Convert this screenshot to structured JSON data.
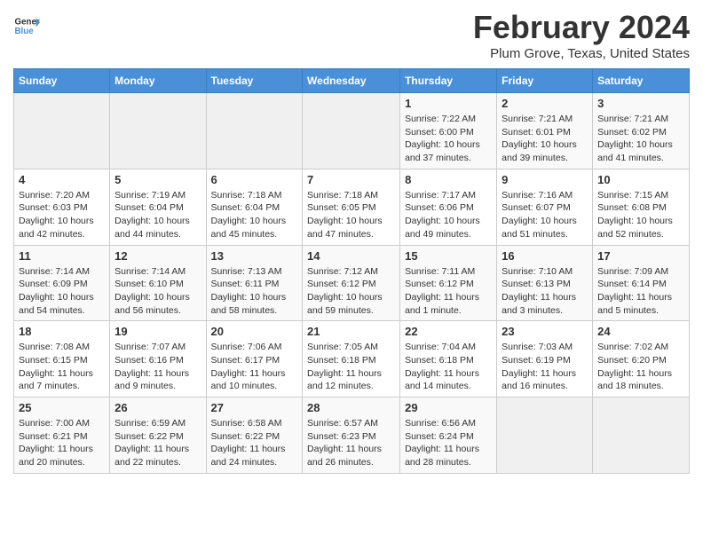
{
  "logo": {
    "line1": "General",
    "line2": "Blue"
  },
  "title": "February 2024",
  "subtitle": "Plum Grove, Texas, United States",
  "days_of_week": [
    "Sunday",
    "Monday",
    "Tuesday",
    "Wednesday",
    "Thursday",
    "Friday",
    "Saturday"
  ],
  "weeks": [
    [
      {
        "num": "",
        "info": ""
      },
      {
        "num": "",
        "info": ""
      },
      {
        "num": "",
        "info": ""
      },
      {
        "num": "",
        "info": ""
      },
      {
        "num": "1",
        "info": "Sunrise: 7:22 AM\nSunset: 6:00 PM\nDaylight: 10 hours\nand 37 minutes."
      },
      {
        "num": "2",
        "info": "Sunrise: 7:21 AM\nSunset: 6:01 PM\nDaylight: 10 hours\nand 39 minutes."
      },
      {
        "num": "3",
        "info": "Sunrise: 7:21 AM\nSunset: 6:02 PM\nDaylight: 10 hours\nand 41 minutes."
      }
    ],
    [
      {
        "num": "4",
        "info": "Sunrise: 7:20 AM\nSunset: 6:03 PM\nDaylight: 10 hours\nand 42 minutes."
      },
      {
        "num": "5",
        "info": "Sunrise: 7:19 AM\nSunset: 6:04 PM\nDaylight: 10 hours\nand 44 minutes."
      },
      {
        "num": "6",
        "info": "Sunrise: 7:18 AM\nSunset: 6:04 PM\nDaylight: 10 hours\nand 45 minutes."
      },
      {
        "num": "7",
        "info": "Sunrise: 7:18 AM\nSunset: 6:05 PM\nDaylight: 10 hours\nand 47 minutes."
      },
      {
        "num": "8",
        "info": "Sunrise: 7:17 AM\nSunset: 6:06 PM\nDaylight: 10 hours\nand 49 minutes."
      },
      {
        "num": "9",
        "info": "Sunrise: 7:16 AM\nSunset: 6:07 PM\nDaylight: 10 hours\nand 51 minutes."
      },
      {
        "num": "10",
        "info": "Sunrise: 7:15 AM\nSunset: 6:08 PM\nDaylight: 10 hours\nand 52 minutes."
      }
    ],
    [
      {
        "num": "11",
        "info": "Sunrise: 7:14 AM\nSunset: 6:09 PM\nDaylight: 10 hours\nand 54 minutes."
      },
      {
        "num": "12",
        "info": "Sunrise: 7:14 AM\nSunset: 6:10 PM\nDaylight: 10 hours\nand 56 minutes."
      },
      {
        "num": "13",
        "info": "Sunrise: 7:13 AM\nSunset: 6:11 PM\nDaylight: 10 hours\nand 58 minutes."
      },
      {
        "num": "14",
        "info": "Sunrise: 7:12 AM\nSunset: 6:12 PM\nDaylight: 10 hours\nand 59 minutes."
      },
      {
        "num": "15",
        "info": "Sunrise: 7:11 AM\nSunset: 6:12 PM\nDaylight: 11 hours\nand 1 minute."
      },
      {
        "num": "16",
        "info": "Sunrise: 7:10 AM\nSunset: 6:13 PM\nDaylight: 11 hours\nand 3 minutes."
      },
      {
        "num": "17",
        "info": "Sunrise: 7:09 AM\nSunset: 6:14 PM\nDaylight: 11 hours\nand 5 minutes."
      }
    ],
    [
      {
        "num": "18",
        "info": "Sunrise: 7:08 AM\nSunset: 6:15 PM\nDaylight: 11 hours\nand 7 minutes."
      },
      {
        "num": "19",
        "info": "Sunrise: 7:07 AM\nSunset: 6:16 PM\nDaylight: 11 hours\nand 9 minutes."
      },
      {
        "num": "20",
        "info": "Sunrise: 7:06 AM\nSunset: 6:17 PM\nDaylight: 11 hours\nand 10 minutes."
      },
      {
        "num": "21",
        "info": "Sunrise: 7:05 AM\nSunset: 6:18 PM\nDaylight: 11 hours\nand 12 minutes."
      },
      {
        "num": "22",
        "info": "Sunrise: 7:04 AM\nSunset: 6:18 PM\nDaylight: 11 hours\nand 14 minutes."
      },
      {
        "num": "23",
        "info": "Sunrise: 7:03 AM\nSunset: 6:19 PM\nDaylight: 11 hours\nand 16 minutes."
      },
      {
        "num": "24",
        "info": "Sunrise: 7:02 AM\nSunset: 6:20 PM\nDaylight: 11 hours\nand 18 minutes."
      }
    ],
    [
      {
        "num": "25",
        "info": "Sunrise: 7:00 AM\nSunset: 6:21 PM\nDaylight: 11 hours\nand 20 minutes."
      },
      {
        "num": "26",
        "info": "Sunrise: 6:59 AM\nSunset: 6:22 PM\nDaylight: 11 hours\nand 22 minutes."
      },
      {
        "num": "27",
        "info": "Sunrise: 6:58 AM\nSunset: 6:22 PM\nDaylight: 11 hours\nand 24 minutes."
      },
      {
        "num": "28",
        "info": "Sunrise: 6:57 AM\nSunset: 6:23 PM\nDaylight: 11 hours\nand 26 minutes."
      },
      {
        "num": "29",
        "info": "Sunrise: 6:56 AM\nSunset: 6:24 PM\nDaylight: 11 hours\nand 28 minutes."
      },
      {
        "num": "",
        "info": ""
      },
      {
        "num": "",
        "info": ""
      }
    ]
  ]
}
